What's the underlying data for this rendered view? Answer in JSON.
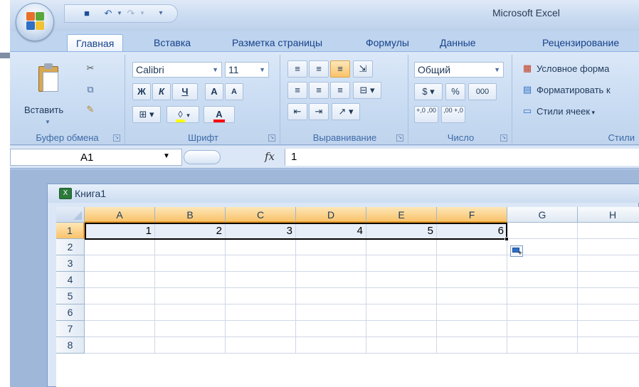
{
  "app": {
    "title": "Microsoft Excel"
  },
  "ribbon_tabs": [
    {
      "label": "Главная",
      "active": true
    },
    {
      "label": "Вставка",
      "active": false
    },
    {
      "label": "Разметка страницы",
      "active": false
    },
    {
      "label": "Формулы",
      "active": false
    },
    {
      "label": "Данные",
      "active": false
    },
    {
      "label": "Рецензирование",
      "active": false
    }
  ],
  "clipboard": {
    "paste_label": "Вставить",
    "group_label": "Буфер обмена"
  },
  "font": {
    "name": "Calibri",
    "size": "11",
    "bold": "Ж",
    "italic": "К",
    "underline": "Ч",
    "grow": "A",
    "shrink": "A",
    "font_color_letter": "A",
    "group_label": "Шрифт"
  },
  "alignment": {
    "group_label": "Выравнивание"
  },
  "number": {
    "format": "Общий",
    "percent": "%",
    "thousands": "000",
    "inc_decimal": "+,0 ,00",
    "dec_decimal": ",00 +,0",
    "group_label": "Число"
  },
  "styles": {
    "conditional": "Условное форма",
    "format_table": "Форматировать к",
    "cell_styles": "Стили ячеек",
    "group_label": "Стили"
  },
  "formula_bar": {
    "name_box": "A1",
    "fx": "fx",
    "value": "1"
  },
  "workbook": {
    "title": "Книга1",
    "icon_letter": "X"
  },
  "sheet": {
    "columns": [
      "A",
      "B",
      "C",
      "D",
      "E",
      "F",
      "G",
      "H"
    ],
    "selected_columns": [
      "A",
      "B",
      "C",
      "D",
      "E",
      "F"
    ],
    "rows": [
      "1",
      "2",
      "3",
      "4",
      "5",
      "6",
      "7",
      "8"
    ],
    "row1_values": [
      "1",
      "2",
      "3",
      "4",
      "5",
      "6"
    ]
  },
  "colors": {
    "ribbon": "#c5d9f1",
    "selected_header": "#f9c36b",
    "tab_text": "#15428b"
  }
}
